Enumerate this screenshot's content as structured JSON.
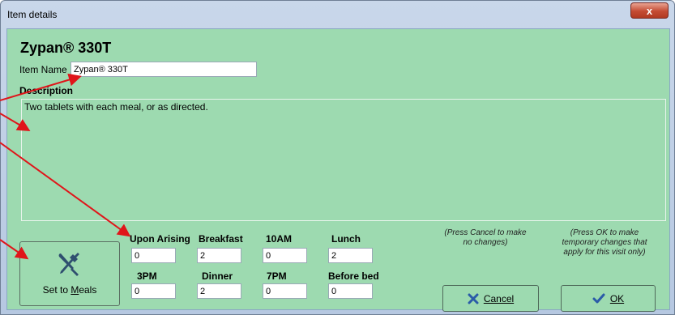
{
  "window": {
    "title": "Item details",
    "close_glyph": "x"
  },
  "item": {
    "heading": "Zypan® 330T",
    "name_label": "Item Name",
    "name_value": "Zypan® 330T"
  },
  "description": {
    "label": "Description",
    "value": "Two tablets with each meal, or as directed."
  },
  "set_to_meals": {
    "label": "Set to Meals",
    "icon": "utensils-icon"
  },
  "schedule": {
    "row1": [
      {
        "label": "Upon Arising",
        "value": "0"
      },
      {
        "label": "Breakfast",
        "value": "2"
      },
      {
        "label": "10AM",
        "value": "0"
      },
      {
        "label": "Lunch",
        "value": "2"
      }
    ],
    "row2": [
      {
        "label": "3PM",
        "value": "0"
      },
      {
        "label": "Dinner",
        "value": "2"
      },
      {
        "label": "7PM",
        "value": "0"
      },
      {
        "label": "Before bed",
        "value": "0"
      }
    ]
  },
  "hints": {
    "cancel_line1": "(Press Cancel to make",
    "cancel_line2": "no changes)",
    "ok_line1": "(Press OK to make",
    "ok_line2": "temporary changes that",
    "ok_line3": "apply for this visit only)"
  },
  "buttons": {
    "cancel_label": "Cancel",
    "ok_label": "OK"
  },
  "colors": {
    "panel_bg": "#9ddab0",
    "arrow": "#e0151a",
    "cancel_icon": "#2a5ba8",
    "ok_icon": "#2a5ba8"
  }
}
